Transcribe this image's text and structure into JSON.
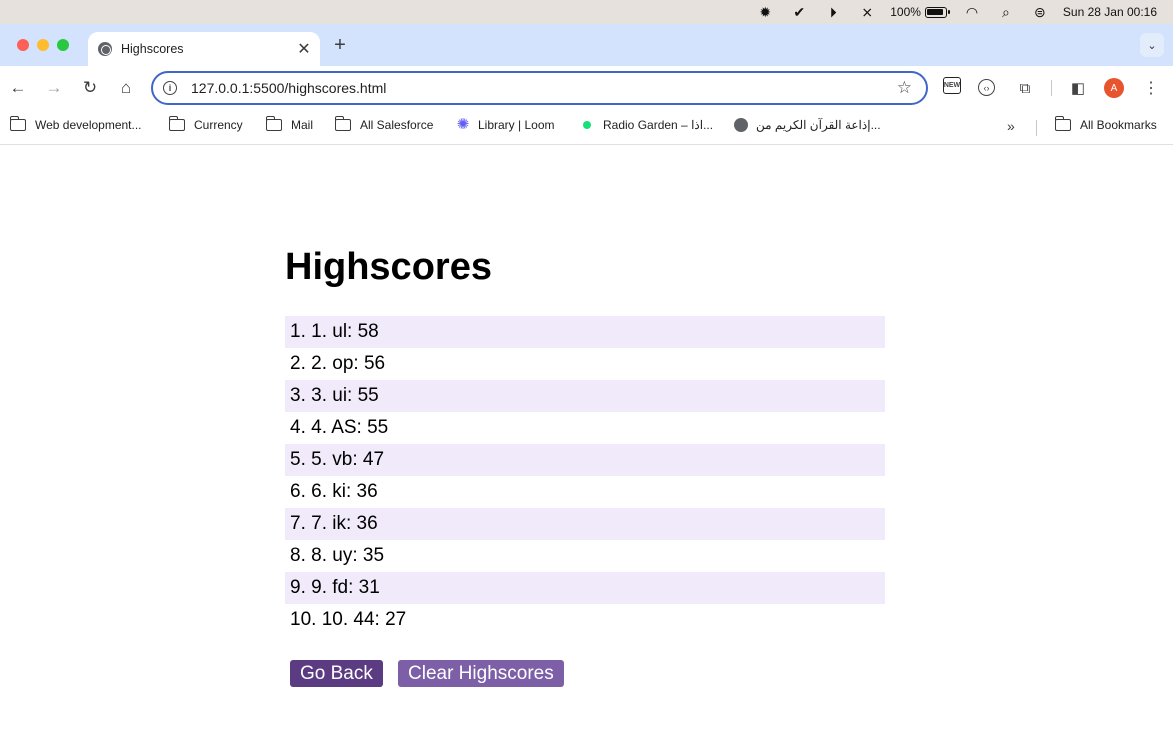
{
  "menubar": {
    "battery": "100%",
    "datetime": "Sun 28 Jan  00:16",
    "icons": [
      "sun-icon",
      "check-badge-icon",
      "play-circle-icon",
      "no-bluetooth-icon",
      "battery-icon",
      "wifi-icon",
      "search-icon",
      "control-center-icon"
    ]
  },
  "browser": {
    "tab": {
      "title": "Highscores",
      "favicon": "globe-icon"
    },
    "url": "127.0.0.1:5500/highscores.html",
    "profile_initial": "A",
    "accent": "#3f67c8"
  },
  "bookmarks": [
    {
      "label": "Web development...",
      "icon": "folder-icon"
    },
    {
      "label": "Currency",
      "icon": "folder-icon"
    },
    {
      "label": "Mail",
      "icon": "folder-icon"
    },
    {
      "label": "All Salesforce",
      "icon": "folder-icon"
    },
    {
      "label": "Library | Loom",
      "icon": "loom-icon"
    },
    {
      "label": "Radio Garden – اذا...",
      "icon": "radio-dot-icon"
    },
    {
      "label": "إذاعة القرآن الكريم من...",
      "icon": "globe-icon"
    }
  ],
  "all_bookmarks": "All Bookmarks",
  "page": {
    "title": "Highscores",
    "scores": [
      "1. 1. ul: 58",
      "2. 2. op: 56",
      "3. 3. ui: 55",
      "4. 4. AS: 55",
      "5. 5. vb: 47",
      "6. 6. ki: 36",
      "7. 7. ik: 36",
      "8. 8. uy: 35",
      "9. 9. fd: 31",
      "10. 10. 44: 27"
    ],
    "go_back": "Go Back",
    "clear": "Clear Highscores",
    "colors": {
      "row_alt": "#f0eafa",
      "go_back": "#5b3b82",
      "clear": "#7c5fa6"
    }
  }
}
